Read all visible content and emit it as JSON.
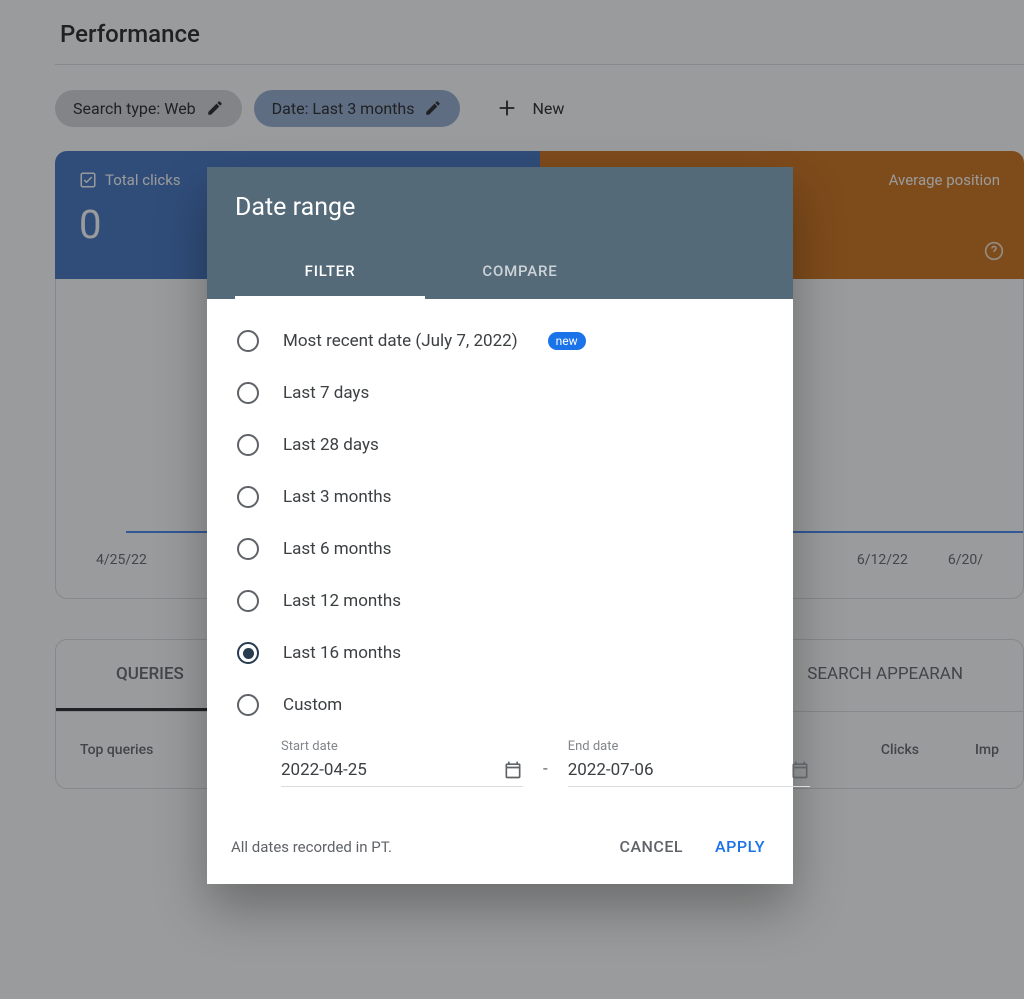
{
  "page": {
    "title": "Performance"
  },
  "filters": {
    "searchType": "Search type: Web",
    "dateFilter": "Date: Last 3 months",
    "newLabel": "New"
  },
  "metrics": {
    "totalClicks": {
      "label": "Total clicks",
      "value": "0"
    },
    "avgPosition": {
      "label": "Average position"
    }
  },
  "chart": {
    "xLabels": [
      "4/25/22",
      "6/12/22",
      "6/20/"
    ]
  },
  "tabs": {
    "queries": "QUERIES",
    "searchAppearance": "SEARCH APPEARAN"
  },
  "table": {
    "colQueries": "Top queries",
    "colClicks": "Clicks",
    "colImpressions": "Imp"
  },
  "modal": {
    "title": "Date range",
    "tabFilter": "FILTER",
    "tabCompare": "COMPARE",
    "options": [
      "Most recent date (July 7, 2022)",
      "Last 7 days",
      "Last 28 days",
      "Last 3 months",
      "Last 6 months",
      "Last 12 months",
      "Last 16 months",
      "Custom"
    ],
    "badgeNew": "new",
    "startLabel": "Start date",
    "startValue": "2022-04-25",
    "endLabel": "End date",
    "endValue": "2022-07-06",
    "footerNote": "All dates recorded in PT.",
    "cancel": "CANCEL",
    "apply": "APPLY"
  }
}
